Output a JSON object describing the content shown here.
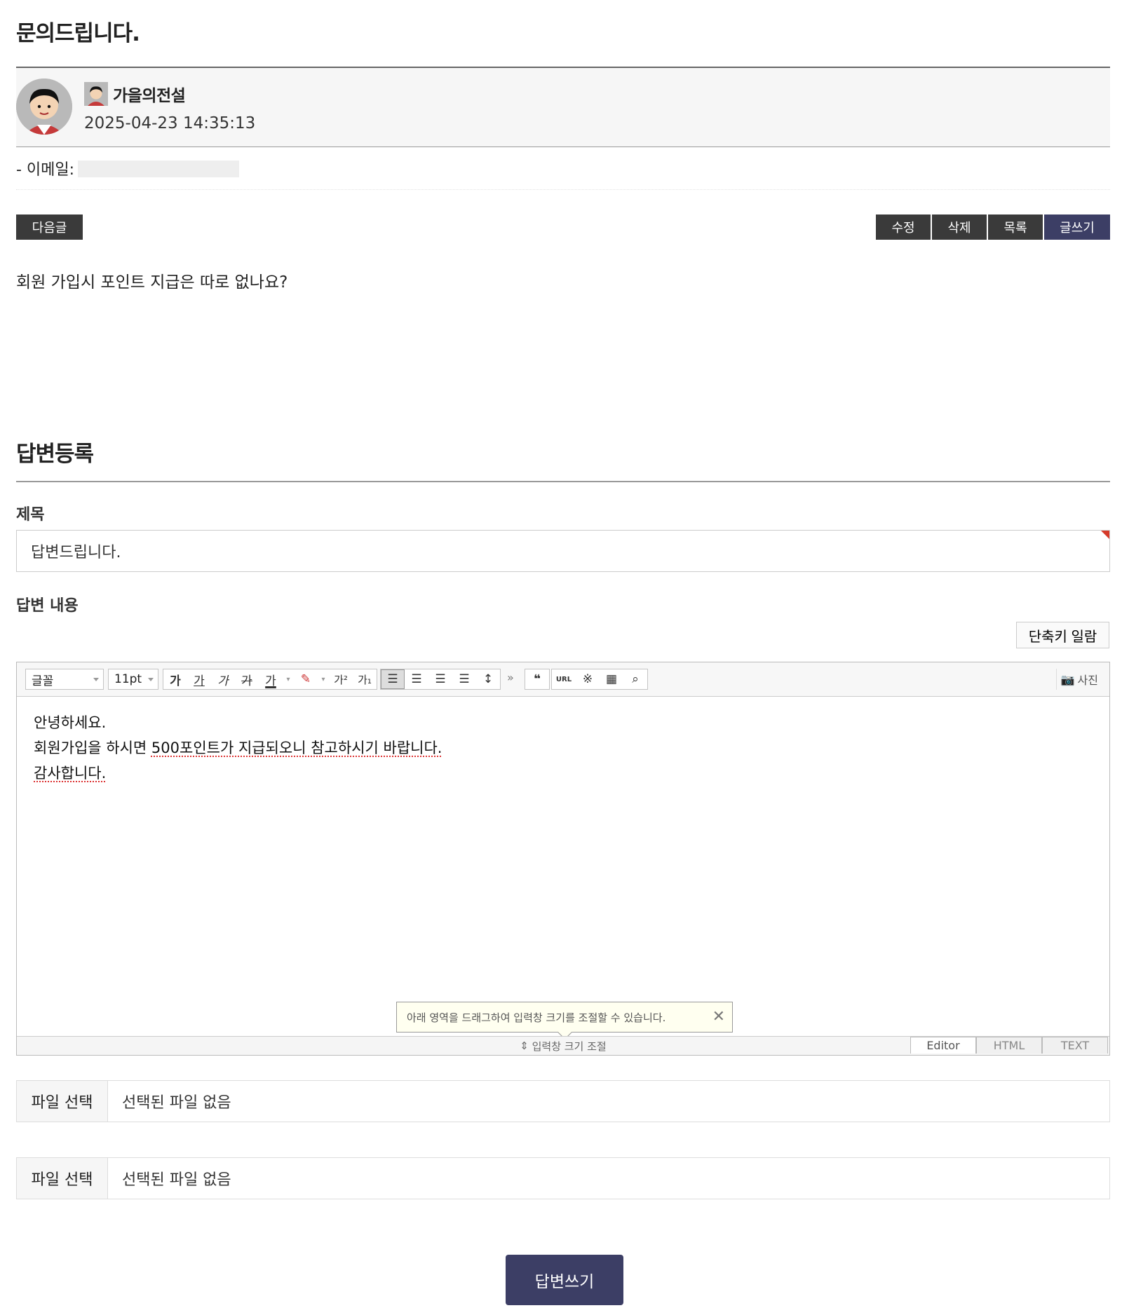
{
  "post": {
    "title": "문의드립니다.",
    "author": "가을의전설",
    "datetime": "2025-04-23 14:35:13",
    "email_label": "- 이메일:",
    "content": "회원 가입시 포인트 지급은 따로 없나요?"
  },
  "actions": {
    "next": "다음글",
    "edit": "수정",
    "delete": "삭제",
    "list": "목록",
    "write": "글쓰기"
  },
  "reply": {
    "section_title": "답변등록",
    "subject_label": "제목",
    "subject_value": "답변드립니다.",
    "content_label": "답변 내용",
    "shortcut_button": "단축키 일람",
    "editor": {
      "font_select": "글꼴",
      "size_select": "11pt",
      "photo_button": "사진",
      "lines": [
        "안녕하세요.",
        "회원가입을 하시면 ",
        "500포인트가 지급되오니 참고하시기 바랍니다.",
        "감사합니다."
      ],
      "tooltip": "아래 영역을 드래그하여 입력창 크기를 조절할 수 있습니다.",
      "resize_label": "입력창 크기 조절",
      "modes": [
        "Editor",
        "HTML",
        "TEXT"
      ]
    },
    "files": [
      {
        "button": "파일 선택",
        "status": "선택된 파일 없음"
      },
      {
        "button": "파일 선택",
        "status": "선택된 파일 없음"
      }
    ],
    "submit": "답변쓰기"
  },
  "colors": {
    "navy": "#3c3e65",
    "dark": "#3a3a3a",
    "required": "#d53a2a"
  }
}
